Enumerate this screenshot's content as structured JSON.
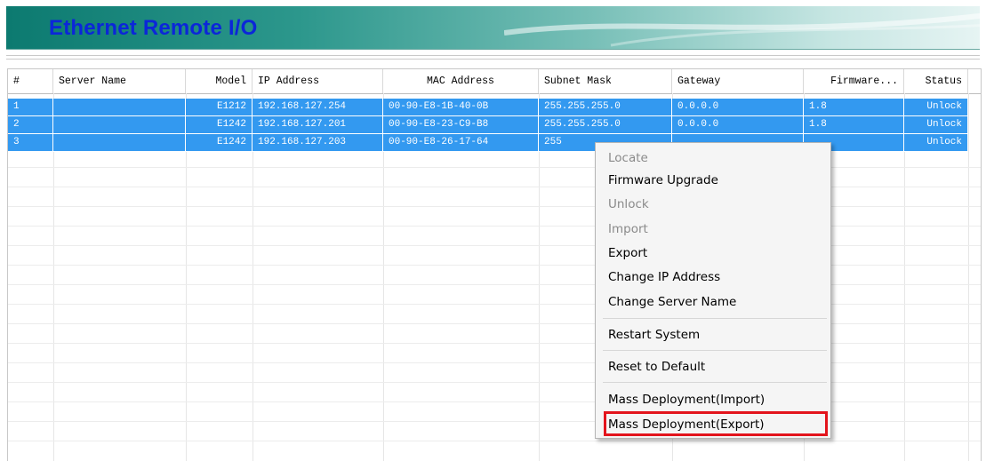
{
  "header": {
    "title": "Ethernet Remote I/O"
  },
  "table": {
    "columns": [
      "#",
      "Server Name",
      "Model",
      "IP Address",
      "MAC Address",
      "Subnet Mask",
      "Gateway",
      "Firmware...",
      "Status"
    ],
    "rows": [
      {
        "num": "1",
        "server_name": "",
        "model": "E1212",
        "ip": "192.168.127.254",
        "mac": "00-90-E8-1B-40-0B",
        "subnet": "255.255.255.0",
        "gateway": "0.0.0.0",
        "firmware": "1.8",
        "status": "Unlock"
      },
      {
        "num": "2",
        "server_name": "",
        "model": "E1242",
        "ip": "192.168.127.201",
        "mac": "00-90-E8-23-C9-B8",
        "subnet": "255.255.255.0",
        "gateway": "0.0.0.0",
        "firmware": "1.8",
        "status": "Unlock"
      },
      {
        "num": "3",
        "server_name": "",
        "model": "E1242",
        "ip": "192.168.127.203",
        "mac": "00-90-E8-26-17-64",
        "subnet": "255",
        "gateway": "",
        "firmware": "",
        "status": "Unlock"
      }
    ]
  },
  "context_menu": {
    "items": [
      {
        "label": "Locate",
        "enabled": false
      },
      {
        "label": "Firmware Upgrade",
        "enabled": true
      },
      {
        "label": "Unlock",
        "enabled": false
      },
      {
        "label": "Import",
        "enabled": false
      },
      {
        "label": "Export",
        "enabled": true
      },
      {
        "label": "Change IP Address",
        "enabled": true
      },
      {
        "label": "Change Server Name",
        "enabled": true
      },
      {
        "label": "Restart System",
        "enabled": true
      },
      {
        "label": "Reset to Default",
        "enabled": true
      },
      {
        "label": "Mass Deployment(Import)",
        "enabled": true
      },
      {
        "label": "Mass Deployment(Export)",
        "enabled": true,
        "highlighted": true
      }
    ]
  },
  "colors": {
    "title_text": "#0b26d9",
    "selection": "#3399f0",
    "highlight_box": "#e3141c"
  }
}
